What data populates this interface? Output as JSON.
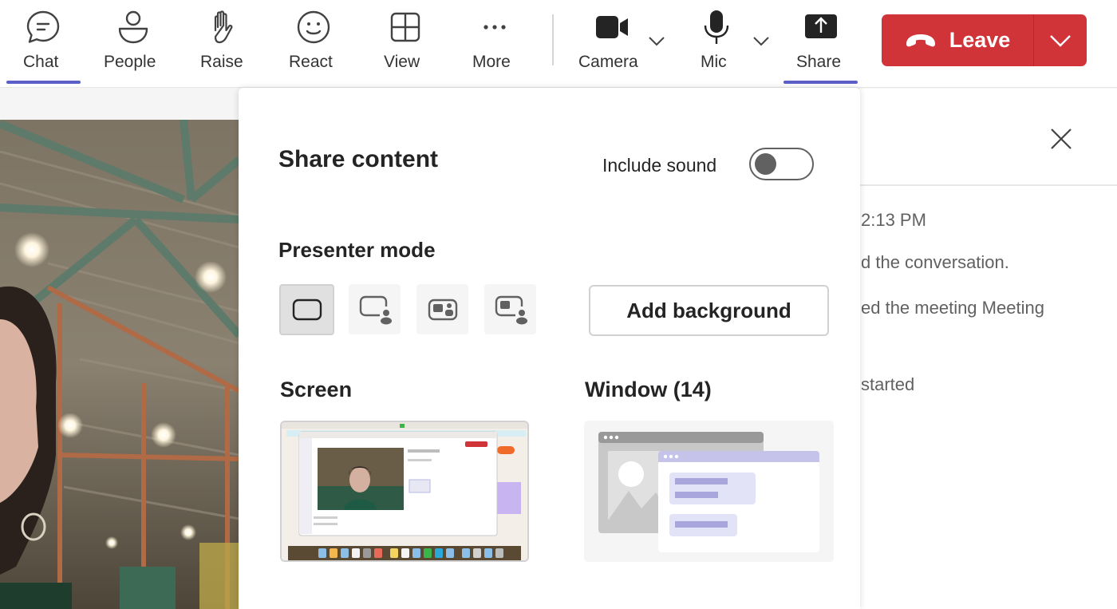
{
  "toolbar": {
    "items": [
      {
        "id": "chat",
        "label": "Chat",
        "icon": "chat-bubble-icon",
        "active": true
      },
      {
        "id": "people",
        "label": "People",
        "icon": "person-icon",
        "active": false
      },
      {
        "id": "raise",
        "label": "Raise",
        "icon": "raised-hand-icon",
        "active": false
      },
      {
        "id": "react",
        "label": "React",
        "icon": "smiley-icon",
        "active": false
      },
      {
        "id": "view",
        "label": "View",
        "icon": "grid-view-icon",
        "active": false
      },
      {
        "id": "more",
        "label": "More",
        "icon": "ellipsis-icon",
        "active": false
      },
      {
        "id": "camera",
        "label": "Camera",
        "icon": "video-camera-icon",
        "active": false
      },
      {
        "id": "mic",
        "label": "Mic",
        "icon": "microphone-icon",
        "active": false
      },
      {
        "id": "share",
        "label": "Share",
        "icon": "share-arrow-up-icon",
        "active": true
      }
    ],
    "leave": {
      "label": "Leave",
      "icon": "phone-hangup-icon"
    }
  },
  "share_panel": {
    "title": "Share content",
    "include_sound": {
      "label": "Include sound",
      "enabled": false
    },
    "presenter_mode": {
      "title": "Presenter mode",
      "options": [
        {
          "name": "content-only",
          "selected": true
        },
        {
          "name": "standout",
          "selected": false
        },
        {
          "name": "side-by-side",
          "selected": false
        },
        {
          "name": "reporter",
          "selected": false
        }
      ],
      "add_background_label": "Add background"
    },
    "screen": {
      "title": "Screen"
    },
    "window": {
      "title": "Window (14)"
    }
  },
  "chat_panel": {
    "messages": [
      "2:13 PM",
      "d the conversation.",
      "ed the meeting Meeting",
      "started"
    ]
  },
  "colors": {
    "accent": "#5b5fc7",
    "leave_red": "#d13438",
    "text_primary": "#242424",
    "text_secondary": "#616161"
  }
}
